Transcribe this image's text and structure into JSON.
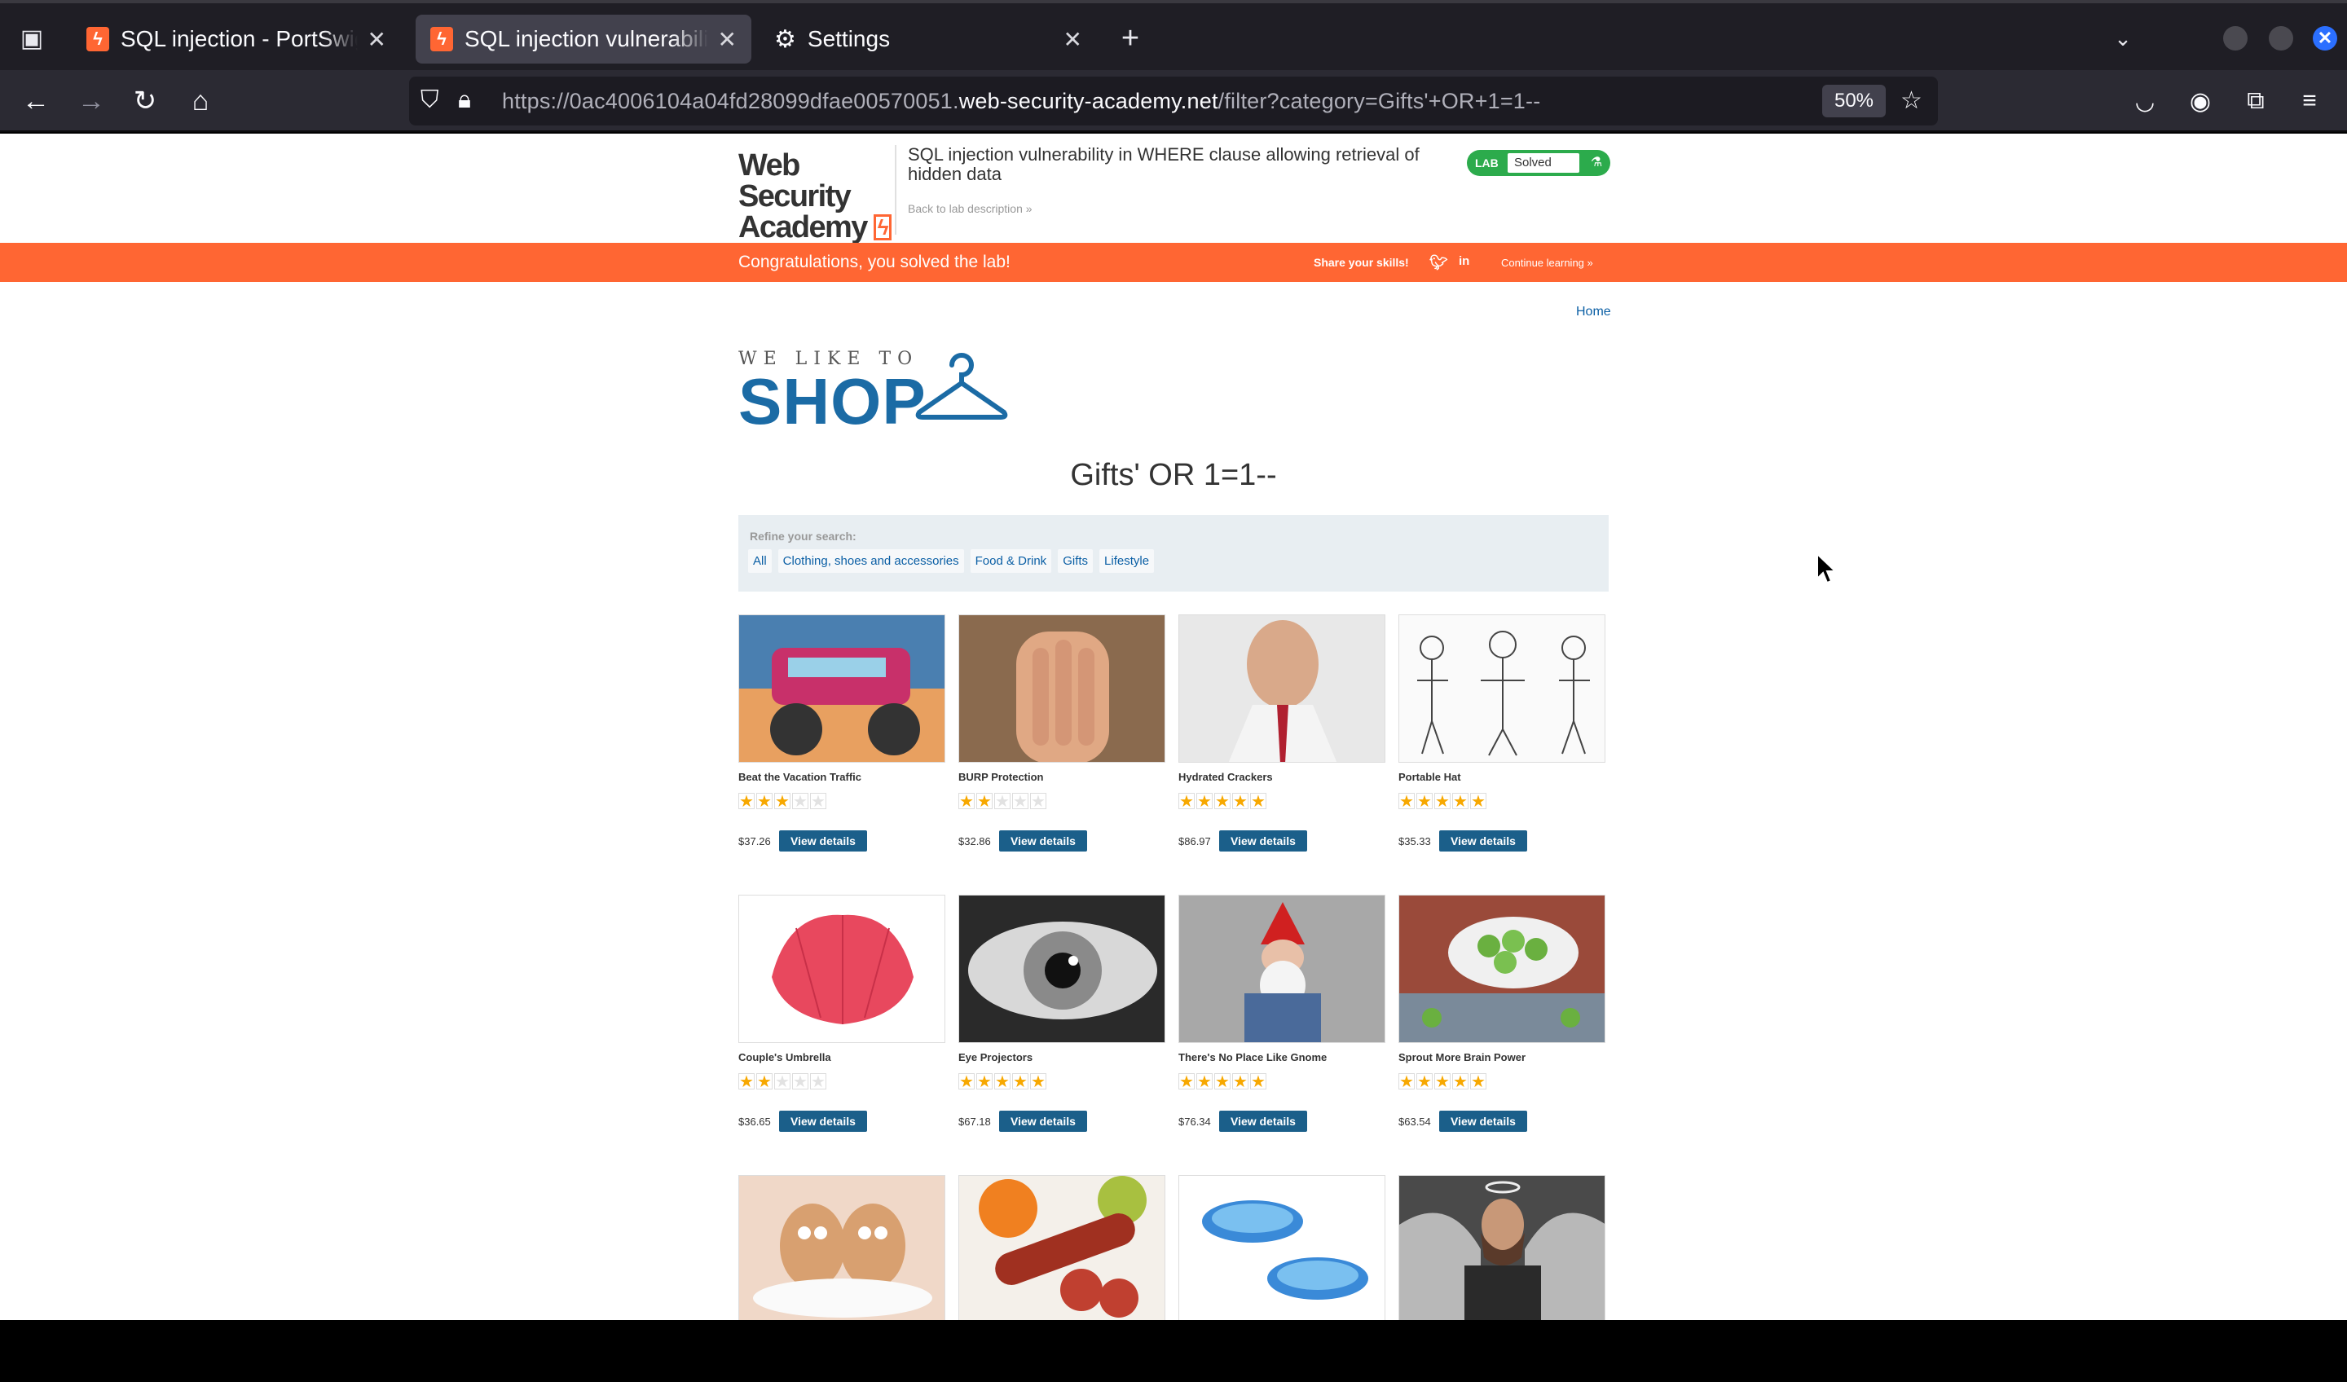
{
  "browser": {
    "tabs": [
      {
        "title": "SQL injection - PortSwigger",
        "active": false,
        "icon": "portswigger-icon"
      },
      {
        "title": "SQL injection vulnerability in WHERE clause",
        "active": true,
        "icon": "portswigger-icon"
      },
      {
        "title": "Settings",
        "active": false,
        "icon": "gear-icon"
      }
    ],
    "url_prefix": "https://0ac4006104a04fd28099dfae00570051.",
    "url_domain": "web-security-academy.net",
    "url_suffix": "/filter?category=Gifts'+OR+1=1--",
    "zoom": "50%"
  },
  "lab": {
    "logo_line1": "Web Security",
    "logo_line2": "Academy",
    "title": "SQL injection vulnerability in WHERE clause allowing retrieval of hidden data",
    "back_link": "Back to lab description",
    "status_tag": "LAB",
    "status": "Solved"
  },
  "banner": {
    "message": "Congratulations, you solved the lab!",
    "share": "Share your skills!",
    "continue": "Continue learning"
  },
  "shop": {
    "home": "Home",
    "logo_tagline": "WE LIKE TO",
    "logo_word": "SHOP",
    "heading": "Gifts' OR 1=1--",
    "refine_label": "Refine your search:",
    "filters": [
      "All",
      "Clothing, shoes and accessories",
      "Food & Drink",
      "Gifts",
      "Lifestyle"
    ],
    "button_label": "View details",
    "products": [
      {
        "name": "Beat the Vacation Traffic",
        "price": "$37.26",
        "rating": 3
      },
      {
        "name": "BURP Protection",
        "price": "$32.86",
        "rating": 2
      },
      {
        "name": "Hydrated Crackers",
        "price": "$86.97",
        "rating": 5
      },
      {
        "name": "Portable Hat",
        "price": "$35.33",
        "rating": 5
      },
      {
        "name": "Couple's Umbrella",
        "price": "$36.65",
        "rating": 2
      },
      {
        "name": "Eye Projectors",
        "price": "$67.18",
        "rating": 5
      },
      {
        "name": "There's No Place Like Gnome",
        "price": "$76.34",
        "rating": 5
      },
      {
        "name": "Sprout More Brain Power",
        "price": "$63.54",
        "rating": 5
      },
      {
        "name": "",
        "price": "",
        "rating": 0
      },
      {
        "name": "",
        "price": "",
        "rating": 0
      },
      {
        "name": "",
        "price": "",
        "rating": 0
      },
      {
        "name": "",
        "price": "",
        "rating": 0
      }
    ]
  },
  "colors": {
    "accent_orange": "#ff6633",
    "solved_green": "#2cab4c",
    "button_blue": "#1b5f8a",
    "star": "#f7a800"
  }
}
